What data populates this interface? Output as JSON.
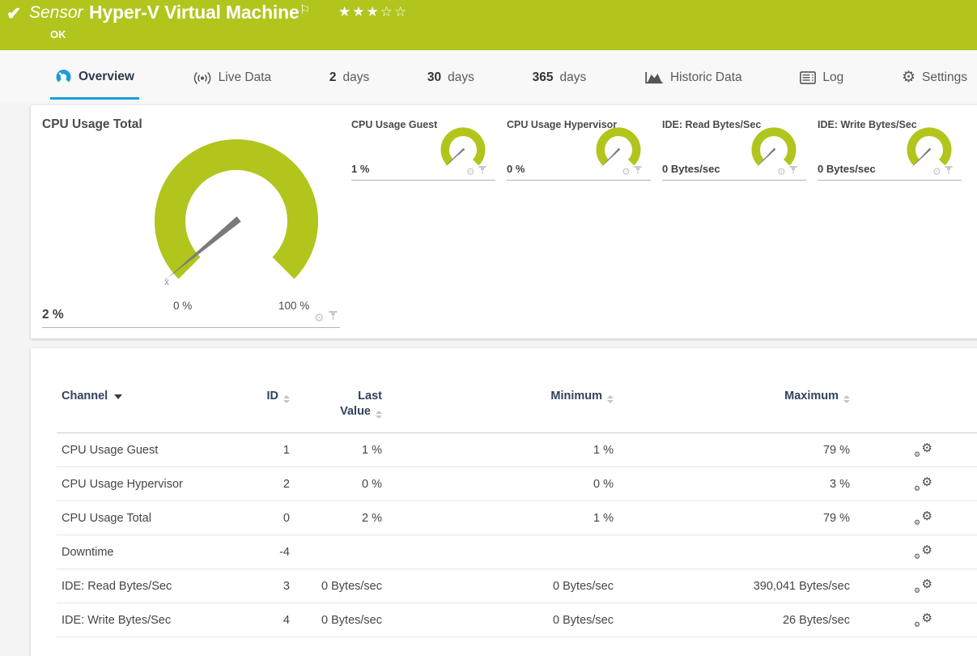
{
  "header": {
    "check_icon": "✔",
    "sensor_label": "Sensor",
    "title": "Hyper-V Virtual Machine",
    "flag_icon": "⚐",
    "rating": "★★★☆☆",
    "status": "OK"
  },
  "tabs": [
    {
      "label": "Overview",
      "active": true
    },
    {
      "label": "Live Data"
    },
    {
      "prefix": "2",
      "label": "days"
    },
    {
      "prefix": "30",
      "label": "days"
    },
    {
      "prefix": "365",
      "label": "days"
    },
    {
      "label": "Historic Data"
    },
    {
      "label": "Log"
    },
    {
      "label": "Settings"
    }
  ],
  "gauges": {
    "main": {
      "title": "CPU Usage Total",
      "value_label": "2 %",
      "value_pct": 2,
      "scale_min": "0 %",
      "scale_max": "100 %",
      "avg_marker": "x̄"
    },
    "small": [
      {
        "title": "CPU Usage Guest",
        "value_label": "1 %",
        "value_pct": 1
      },
      {
        "title": "CPU Usage Hypervisor",
        "value_label": "0 %",
        "value_pct": 0
      },
      {
        "title": "IDE: Read Bytes/Sec",
        "value_label": "0 Bytes/sec",
        "value_pct": 0
      },
      {
        "title": "IDE: Write Bytes/Sec",
        "value_label": "0 Bytes/sec",
        "value_pct": 0
      }
    ]
  },
  "table": {
    "headers": {
      "channel": "Channel",
      "id": "ID",
      "last1": "Last",
      "last2": "Value",
      "min": "Minimum",
      "max": "Maximum"
    },
    "rows": [
      {
        "channel": "CPU Usage Guest",
        "id": "1",
        "last": "1 %",
        "min": "1 %",
        "max": "79 %"
      },
      {
        "channel": "CPU Usage Hypervisor",
        "id": "2",
        "last": "0 %",
        "min": "0 %",
        "max": "3 %"
      },
      {
        "channel": "CPU Usage Total",
        "id": "0",
        "last": "2 %",
        "min": "1 %",
        "max": "79 %"
      },
      {
        "channel": "Downtime",
        "id": "-4",
        "last": "",
        "min": "",
        "max": ""
      },
      {
        "channel": "IDE: Read Bytes/Sec",
        "id": "3",
        "last": "0 Bytes/sec",
        "min": "0 Bytes/sec",
        "max": "390,041 Bytes/sec"
      },
      {
        "channel": "IDE: Write Bytes/Sec",
        "id": "4",
        "last": "0 Bytes/sec",
        "min": "0 Bytes/sec",
        "max": "26 Bytes/sec"
      }
    ]
  },
  "colors": {
    "brand_green": "#b1c51d",
    "accent_blue": "#1b9dd9",
    "header_text": "#32425c",
    "needle_gray": "#7a7a7a"
  }
}
